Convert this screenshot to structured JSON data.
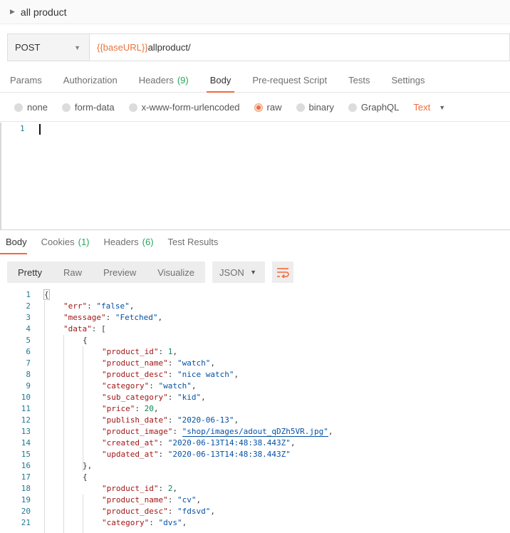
{
  "request": {
    "title": "all product",
    "method": "POST",
    "url_var": "{{baseURL}}",
    "url_path": "allproduct/"
  },
  "request_tabs": [
    {
      "label": "Params",
      "count": ""
    },
    {
      "label": "Authorization",
      "count": ""
    },
    {
      "label": "Headers",
      "count": "(9)"
    },
    {
      "label": "Body",
      "count": "",
      "active": true
    },
    {
      "label": "Pre-request Script",
      "count": ""
    },
    {
      "label": "Tests",
      "count": ""
    },
    {
      "label": "Settings",
      "count": ""
    }
  ],
  "body_types": [
    {
      "label": "none"
    },
    {
      "label": "form-data"
    },
    {
      "label": "x-www-form-urlencoded"
    },
    {
      "label": "raw",
      "selected": true
    },
    {
      "label": "binary"
    },
    {
      "label": "GraphQL"
    }
  ],
  "raw_type": "Text",
  "editor": {
    "line": "1"
  },
  "response_tabs": [
    {
      "label": "Body",
      "count": "",
      "active": true
    },
    {
      "label": "Cookies",
      "count": "(1)"
    },
    {
      "label": "Headers",
      "count": "(6)"
    },
    {
      "label": "Test Results",
      "count": ""
    }
  ],
  "view_modes": [
    "Pretty",
    "Raw",
    "Preview",
    "Visualize"
  ],
  "format": "JSON",
  "colors": {
    "accent": "#f26b3a",
    "count": "#26a65b",
    "var": "#e8743b"
  },
  "response_lines": [
    {
      "n": "1",
      "indent": 0,
      "text": "{"
    },
    {
      "n": "2",
      "indent": 1,
      "key": "err",
      "val": "\"false\"",
      "type": "s",
      "tail": ","
    },
    {
      "n": "3",
      "indent": 1,
      "key": "message",
      "val": "\"Fetched\"",
      "type": "s",
      "tail": ","
    },
    {
      "n": "4",
      "indent": 1,
      "key": "data",
      "val": "[",
      "type": "p",
      "tail": ""
    },
    {
      "n": "5",
      "indent": 2,
      "text": "{"
    },
    {
      "n": "6",
      "indent": 3,
      "key": "product_id",
      "val": "1",
      "type": "n",
      "tail": ","
    },
    {
      "n": "7",
      "indent": 3,
      "key": "product_name",
      "val": "\"watch\"",
      "type": "s",
      "tail": ","
    },
    {
      "n": "8",
      "indent": 3,
      "key": "product_desc",
      "val": "\"nice watch\"",
      "type": "s",
      "tail": ","
    },
    {
      "n": "9",
      "indent": 3,
      "key": "category",
      "val": "\"watch\"",
      "type": "s",
      "tail": ","
    },
    {
      "n": "10",
      "indent": 3,
      "key": "sub_category",
      "val": "\"kid\"",
      "type": "s",
      "tail": ","
    },
    {
      "n": "11",
      "indent": 3,
      "key": "price",
      "val": "20",
      "type": "n",
      "tail": ","
    },
    {
      "n": "12",
      "indent": 3,
      "key": "publish_date",
      "val": "\"2020-06-13\"",
      "type": "s",
      "tail": ","
    },
    {
      "n": "13",
      "indent": 3,
      "key": "product_image",
      "val": "\"shop/images/adout_qDZh5VR.jpg\"",
      "type": "s",
      "tail": ",",
      "link": true
    },
    {
      "n": "14",
      "indent": 3,
      "key": "created_at",
      "val": "\"2020-06-13T14:48:38.443Z\"",
      "type": "s",
      "tail": ","
    },
    {
      "n": "15",
      "indent": 3,
      "key": "updated_at",
      "val": "\"2020-06-13T14:48:38.443Z\"",
      "type": "s",
      "tail": ""
    },
    {
      "n": "16",
      "indent": 2,
      "text": "},"
    },
    {
      "n": "17",
      "indent": 2,
      "text": "{"
    },
    {
      "n": "18",
      "indent": 3,
      "key": "product_id",
      "val": "2",
      "type": "n",
      "tail": ","
    },
    {
      "n": "19",
      "indent": 3,
      "key": "product_name",
      "val": "\"cv\"",
      "type": "s",
      "tail": ","
    },
    {
      "n": "20",
      "indent": 3,
      "key": "product_desc",
      "val": "\"fdsvd\"",
      "type": "s",
      "tail": ","
    },
    {
      "n": "21",
      "indent": 3,
      "key": "category",
      "val": "\"dvs\"",
      "type": "s",
      "tail": ","
    }
  ]
}
